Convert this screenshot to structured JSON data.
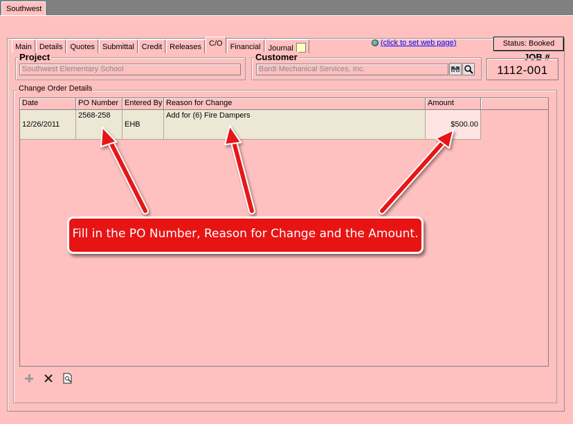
{
  "window": {
    "tab_label": "Southwest"
  },
  "tabs": [
    {
      "label": "Main",
      "active": false
    },
    {
      "label": "Details",
      "active": false
    },
    {
      "label": "Quotes",
      "active": false
    },
    {
      "label": "Submittal",
      "active": false
    },
    {
      "label": "Credit",
      "active": false
    },
    {
      "label": "Releases",
      "active": false
    },
    {
      "label": "C/O",
      "active": true
    },
    {
      "label": "Financial",
      "active": false
    },
    {
      "label": "Journal",
      "active": false
    }
  ],
  "web_link": {
    "text": "(click to set web page)",
    "icon": "globe-icon"
  },
  "status_button": {
    "label": "Status: Booked"
  },
  "project": {
    "label": "Project",
    "value": "Southwest Elementary School"
  },
  "customer": {
    "label": "Customer",
    "value": "Bardi Mechanical Services, Inc.",
    "icons": [
      "binoculars-icon",
      "magnifier-icon"
    ]
  },
  "job": {
    "label": "JOB #",
    "number": "1112-001"
  },
  "change_orders": {
    "section_label": "Change Order Details",
    "columns": [
      "Date",
      "PO Number",
      "Entered By",
      "Reason for Change",
      "Amount"
    ],
    "rows": [
      {
        "date": "12/26/2011",
        "po_number": "2568-258",
        "entered_by": "EHB",
        "reason": "Add for (6) Fire Dampers",
        "amount": "$500.00"
      }
    ]
  },
  "toolbar": {
    "icons": [
      "add-icon",
      "delete-icon",
      "preview-icon"
    ]
  },
  "annotation": {
    "text": "Fill in the PO Number, Reason for Change and the Amount."
  },
  "colors": {
    "background": "#ffc0c0",
    "callout": "#e81414",
    "row_fill": "#ede8d6",
    "amount_fill": "#ffe4e4",
    "link": "#0000ff"
  }
}
